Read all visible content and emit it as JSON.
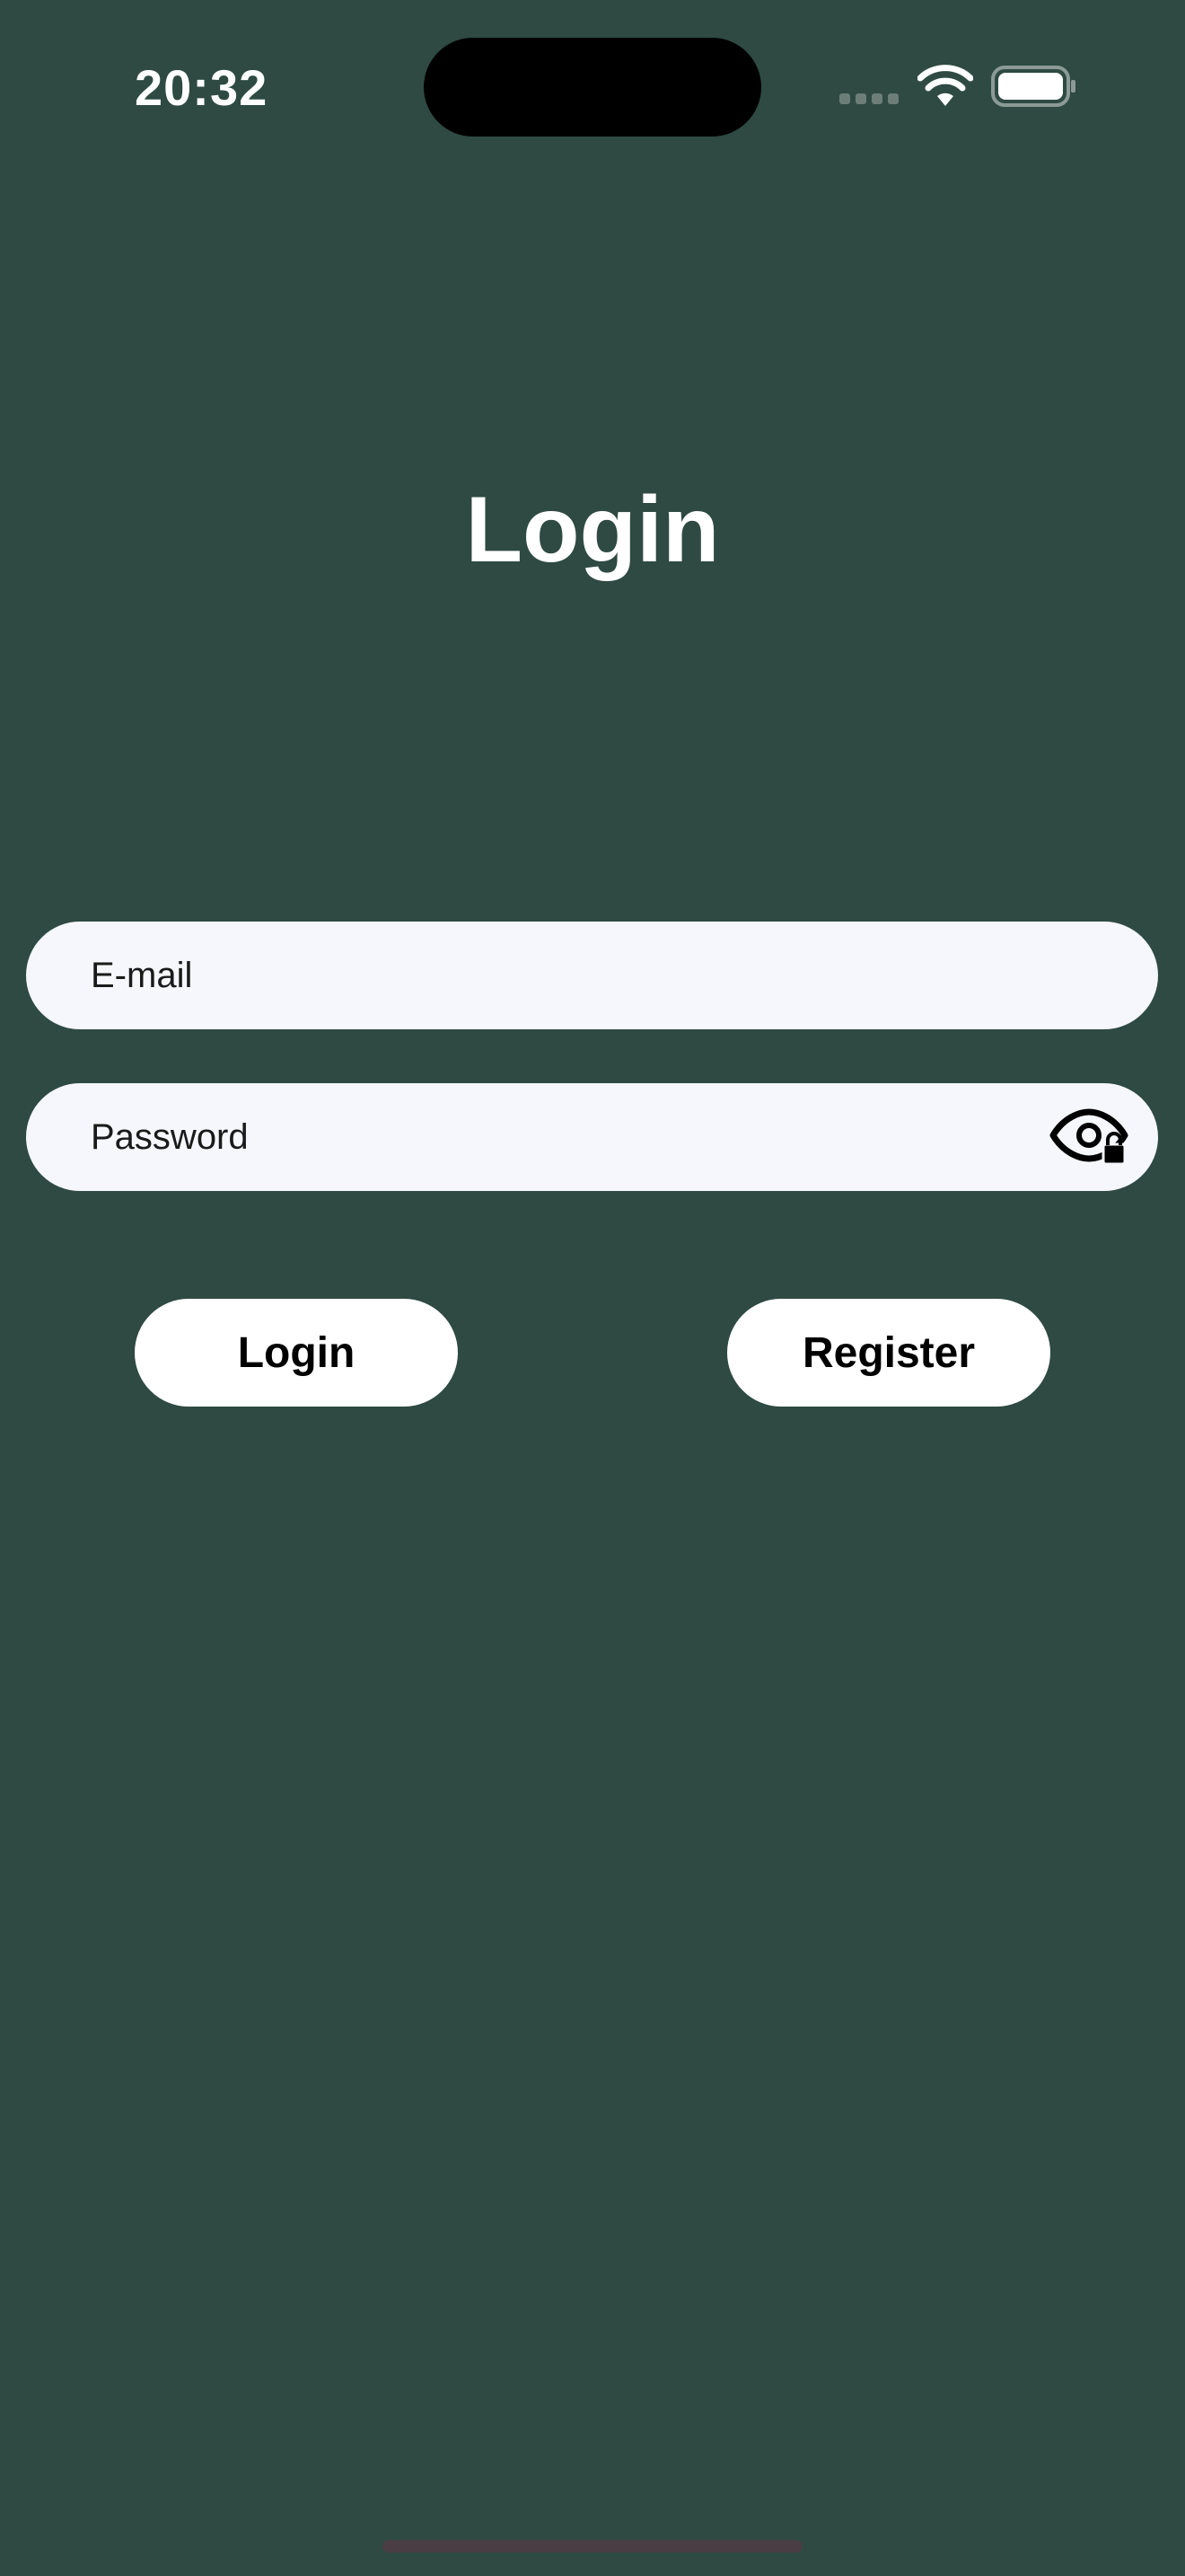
{
  "status_bar": {
    "time": "20:32",
    "icons": [
      "signal-icon",
      "wifi-icon",
      "battery-icon"
    ]
  },
  "page": {
    "title": "Login"
  },
  "form": {
    "email_placeholder": "E-mail",
    "email_value": "",
    "password_placeholder": "Password",
    "password_value": "",
    "password_toggle_icon": "eye-lock-icon"
  },
  "actions": {
    "login_label": "Login",
    "register_label": "Register"
  },
  "colors": {
    "background": "#2e4a42",
    "field_background": "#f5f7fc",
    "button_background": "#ffffff",
    "title_text": "#ffffff",
    "button_text": "#000000"
  }
}
